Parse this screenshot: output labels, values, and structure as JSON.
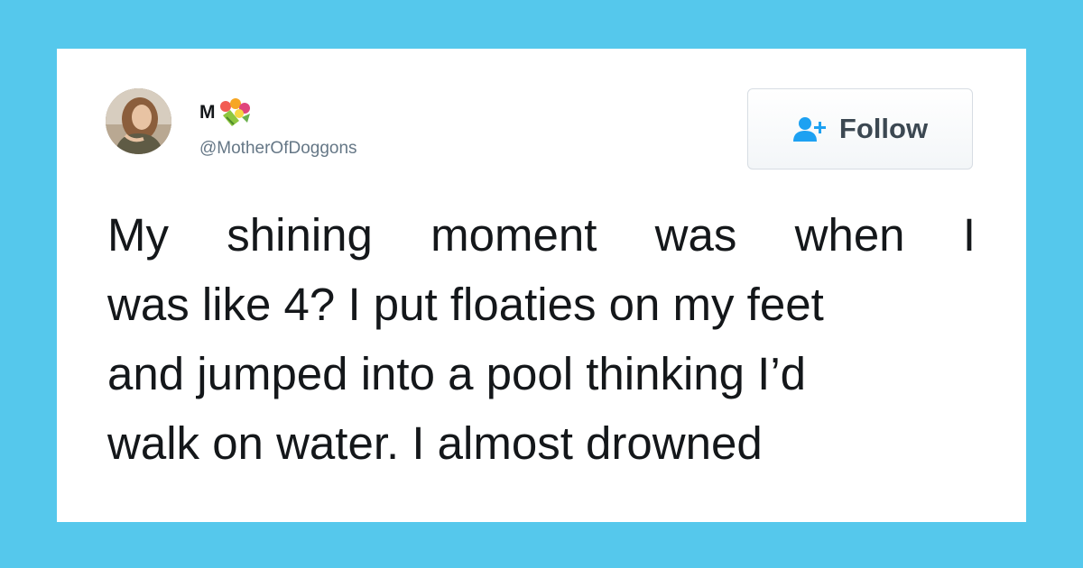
{
  "user": {
    "display_name": "M",
    "display_name_emoji": "tulip-bouquet-icon",
    "handle": "@MotherOfDoggons",
    "avatar": "profile-photo"
  },
  "follow_button": {
    "label": "Follow",
    "icon": "add-user-icon"
  },
  "tweet": {
    "lines": [
      "My shining moment was when I",
      "was like 4? I put floaties on my feet",
      "and jumped into a pool thinking I’d",
      "walk on water. I almost drowned"
    ]
  },
  "colors": {
    "background": "#55c8ec",
    "card": "#ffffff",
    "twitter_blue": "#1da1f2",
    "text": "#14171a",
    "handle": "#657786"
  }
}
